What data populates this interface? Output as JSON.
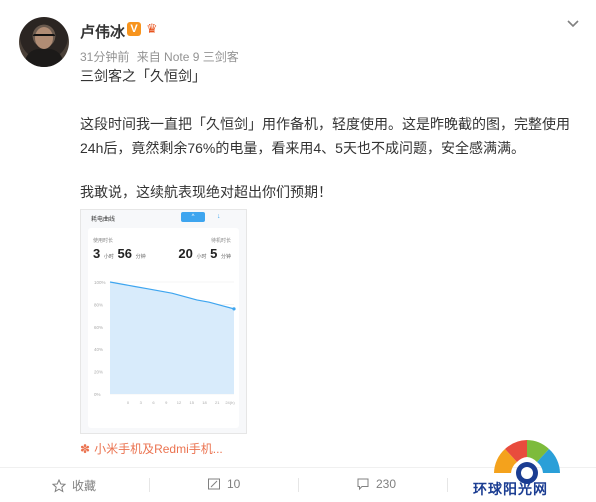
{
  "post": {
    "author": "卢伟冰",
    "verified_badge": "V",
    "time": "31分钟前",
    "source": "来自 Note 9 三剑客",
    "paragraphs": [
      "三剑客之「久恒剑」",
      "这段时间我一直把「久恒剑」用作备机，轻度使用。这是昨晚截的图，完整使用",
      "24h后，竟然剩余76%的电量，看来用4、5天也不成问题，安全感满满。",
      "我敢说，这续航表现绝对超出你们预期！"
    ],
    "topic_link": "小米手机及Redmi手机..."
  },
  "screenshot": {
    "title": "耗电曲线",
    "toggle": "^",
    "left_label": "使用时长",
    "right_label": "待机时长",
    "use_hours": "3",
    "use_hours_unit": "小时",
    "use_minutes": "56",
    "use_minutes_unit": "分钟",
    "standby_hours": "20",
    "standby_hours_unit": "小时",
    "standby_minutes": "5",
    "standby_minutes_unit": "分钟"
  },
  "chart_data": {
    "type": "area",
    "title": "",
    "y_ticks": [
      "100%",
      "80%",
      "60%",
      "40%",
      "20%",
      "0%"
    ],
    "x_ticks": [
      "0",
      "3",
      "6",
      "9",
      "12",
      "15",
      "18",
      "21",
      "24(h)"
    ],
    "series": [
      {
        "values": [
          100,
          98,
          96,
          94,
          92,
          90,
          87,
          84,
          82,
          79,
          76
        ]
      }
    ],
    "ylim": [
      0,
      100
    ],
    "color": "#3ea5ef"
  },
  "actions": {
    "favorite": "收藏",
    "repost": "10",
    "comment": "230",
    "like": ""
  },
  "watermark": "环球阳光网",
  "colors": {
    "accent": "#eb7350",
    "brand_blue": "#3ea5ef"
  }
}
